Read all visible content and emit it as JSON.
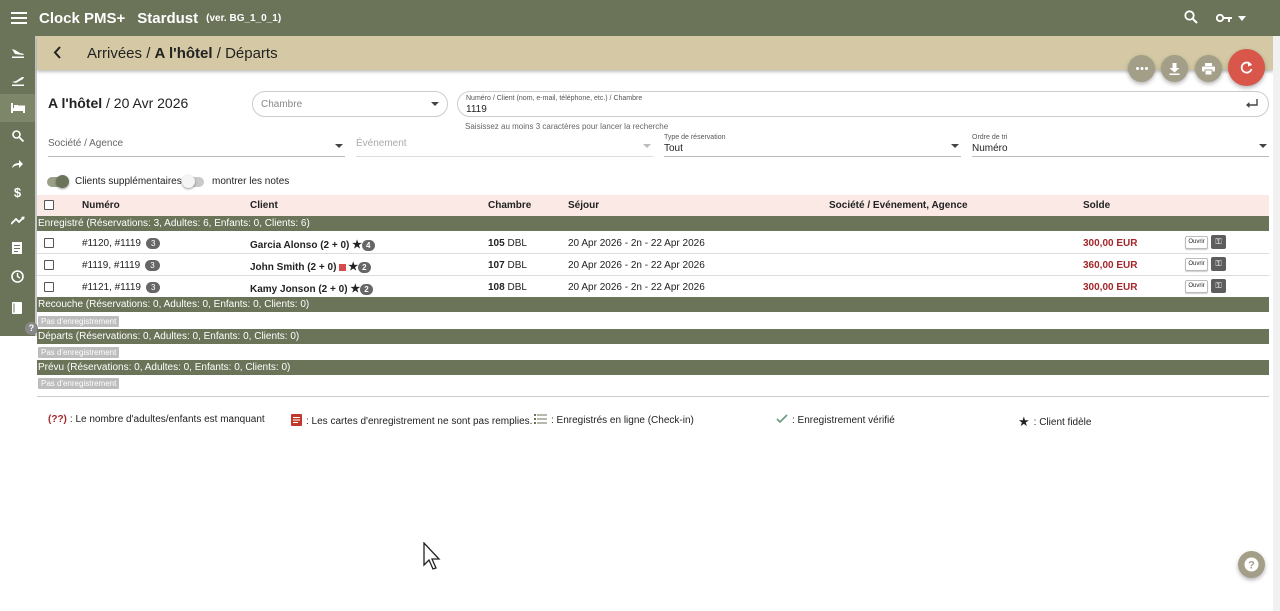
{
  "topbar": {
    "app_name": "Clock PMS+",
    "property": "Stardust",
    "version": "(ver. BG_1_0_1)"
  },
  "breadcrumb": {
    "item1": "Arrivées",
    "sep": "/",
    "item2": "A l'hôtel",
    "item3": "Départs"
  },
  "page": {
    "title": "A l'hôtel",
    "date": "/ 20 Avr 2026"
  },
  "filters": {
    "chambre_placeholder": "Chambre",
    "search_label": "Numéro / Client (nom, e-mail, téléphone, etc.) / Chambre",
    "search_value": "1119",
    "search_hint": "Saisissez au moins 3 caractères pour lancer la recherche",
    "societe_placeholder": "Société / Agence",
    "evenement_placeholder": "Événement",
    "type_label": "Type de réservation",
    "type_value": "Tout",
    "ordre_label": "Ordre de tri",
    "ordre_value": "Numéro"
  },
  "toggles": {
    "clients_supp": "Clients supplémentaires",
    "clients_supp_on": true,
    "notes": "montrer les notes",
    "notes_on": false
  },
  "table": {
    "headers": {
      "numero": "Numéro",
      "client": "Client",
      "chambre": "Chambre",
      "sejour": "Séjour",
      "societe": "Société / Evénement, Agence",
      "solde": "Solde"
    },
    "groups": [
      {
        "label": "Enregistré (Réservations: 3, Adultes: 6, Enfants: 0, Clients: 6)"
      },
      {
        "label": "Recouche (Réservations: 0, Adultes: 0, Enfants: 0, Clients: 0)",
        "empty": "Pas d'enregistrement"
      },
      {
        "label": "Départs (Réservations: 0, Adultes: 0, Enfants: 0, Clients: 0)",
        "empty": "Pas d'enregistrement"
      },
      {
        "label": "Prévu (Réservations: 0, Adultes: 0, Enfants: 0, Clients: 0)",
        "empty": "Pas d'enregistrement"
      }
    ],
    "rows": [
      {
        "numero": "#1120, #1119",
        "count": "3",
        "client": "Garcia Alonso (2 + 0)",
        "stars": "4",
        "room_no": "105",
        "room_type": "DBL",
        "sejour": "20 Apr 2026 - 2n - 22 Apr 2026",
        "solde": "300,00 EUR",
        "open": "Ouvrir"
      },
      {
        "numero": "#1119, #1119",
        "count": "3",
        "client": "John Smith (2 + 0)",
        "stars": "2",
        "room_no": "107",
        "room_type": "DBL",
        "sejour": "20 Apr 2026 - 2n - 22 Apr 2026",
        "solde": "360,00 EUR",
        "open": "Ouvrir"
      },
      {
        "numero": "#1121, #1119",
        "count": "3",
        "client": "Kamy Jonson (2 + 0)",
        "stars": "2",
        "room_no": "108",
        "room_type": "DBL",
        "sejour": "20 Apr 2026 - 2n - 22 Apr 2026",
        "solde": "300,00 EUR",
        "open": "Ouvrir"
      }
    ]
  },
  "legend": {
    "missing_code": "(??)",
    "missing": ": Le nombre d'adultes/enfants est manquant",
    "cards": ": Les cartes d'enregistrement ne sont pas remplies.",
    "online": ": Enregistrés en ligne (Check-in)",
    "verified": ": Enregistrement vérifié",
    "loyal": ": Client fidèle"
  },
  "colors": {
    "primary": "#6b7459",
    "crumb_bg": "#d4c9a4",
    "accent_red": "#d9564a",
    "balance": "#a3262a"
  }
}
